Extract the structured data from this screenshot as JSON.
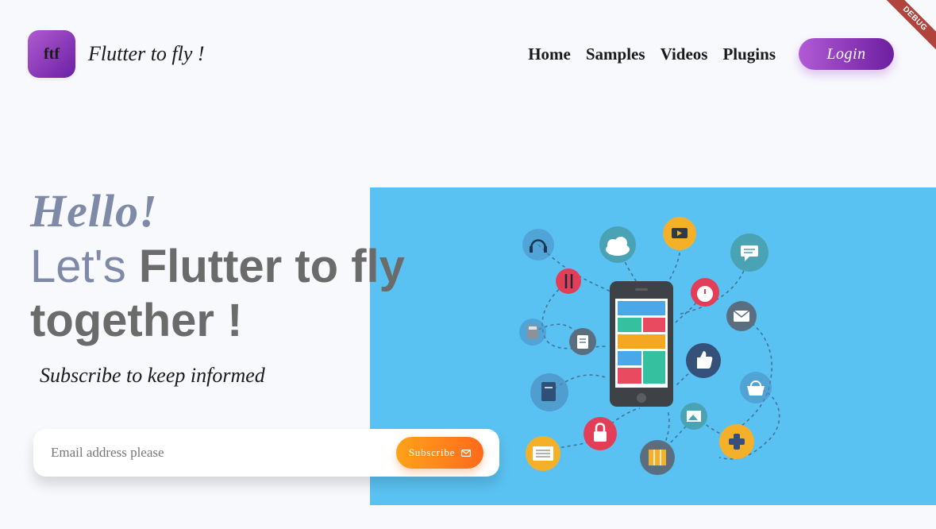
{
  "header": {
    "logo_text": "ftf",
    "site_name": "Flutter to fly !",
    "nav": [
      "Home",
      "Samples",
      "Videos",
      "Plugins"
    ],
    "login_label": "Login"
  },
  "debug_banner": "DEBUG",
  "hero": {
    "hello": "Hello!",
    "headline_soft": "Let's",
    "headline_strong_1": "Flutter to fly",
    "headline_strong_2": "together !",
    "subscribe_caption": "Subscribe to keep informed",
    "email_placeholder": "Email address please",
    "subscribe_label": "Subscribe"
  },
  "colors": {
    "accent_purple": "#8e3cc2",
    "accent_orange": "#ff7f1a",
    "hero_bg": "#5ac2f2"
  }
}
